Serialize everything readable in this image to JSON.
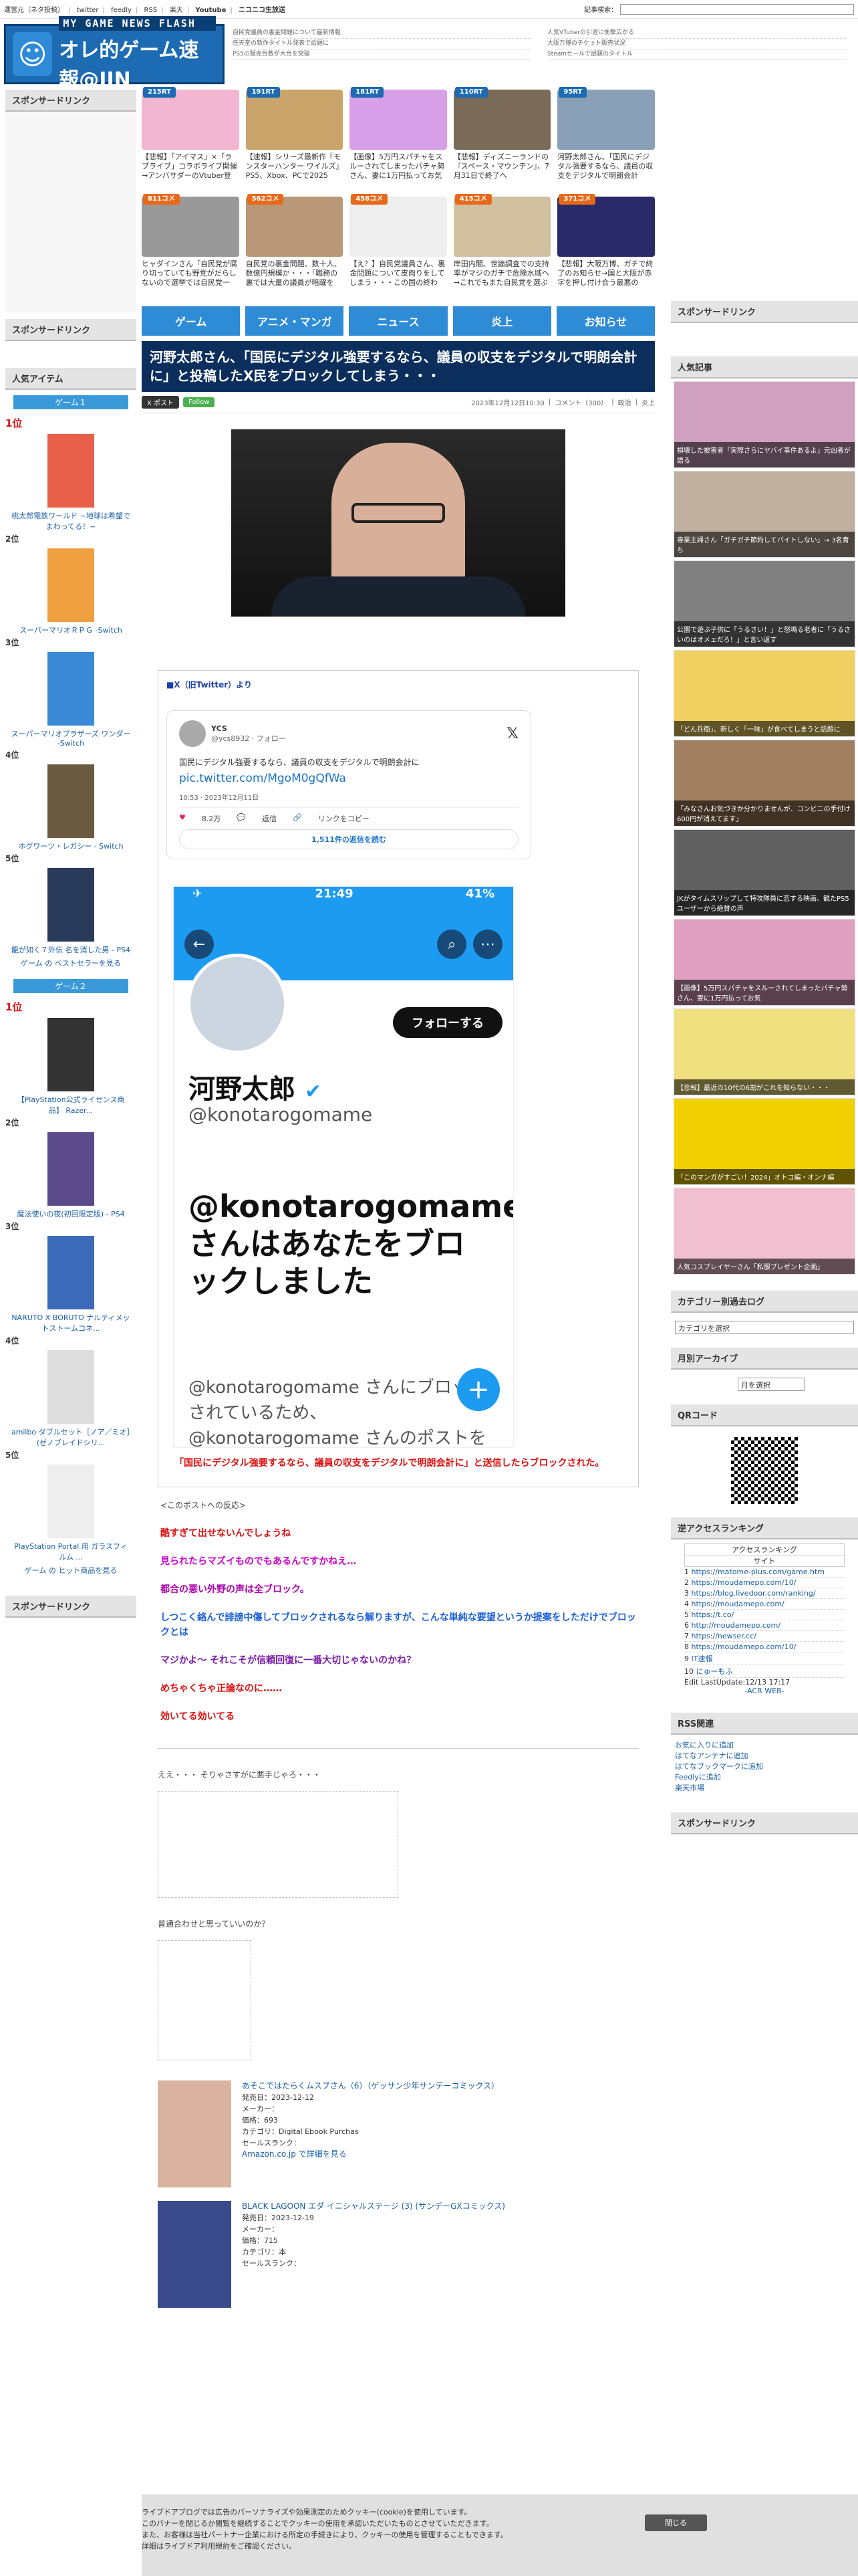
{
  "topbar": {
    "links": [
      "運営元（ネタ投稿）",
      "twitter",
      "feedly",
      "RSS",
      "楽天",
      "Youtube",
      "ニコニコ生放送"
    ],
    "search_label": "記事検索："
  },
  "header": {
    "logo_en": "MY GAME NEWS FLASH",
    "logo_jp": "オレ的ゲーム速報@JIN"
  },
  "trending": [
    {
      "badge": "215RT",
      "text": "【悲報】「アイマス」×「ラブライブ」コラボライブ開催→アンバサダーのVtuber登"
    },
    {
      "badge": "191RT",
      "text": "【速報】シリーズ最新作『モンスターハンター ワイルズ』PS5、Xbox、PCで2025"
    },
    {
      "badge": "181RT",
      "text": "【画像】5万円スパチャをスルーされてしまったパチャ勢さん、妻に1万円払ってお気"
    },
    {
      "badge": "110RT",
      "text": "【悲報】ディズニーランドの『スペース・マウンテン』、7月31日で終了へ"
    },
    {
      "badge": "95RT",
      "text": "河野太郎さん、「国民にデジタル強要するなら、議員の収支をデジタルで明朗会計"
    },
    {
      "badge": "811コメ",
      "text": "ヒャダインさん「自民党が腐り切っていても野党がだらしないので選挙では自民党一",
      "c": true
    },
    {
      "badge": "562コメ",
      "text": "自民党の裏金問題、数十人、数億円規模か・・・「職務の裏では大量の議員が暗躍を",
      "c": true
    },
    {
      "badge": "458コメ",
      "text": "【え？】自民党議員さん、裏金問題について皮肉りをしてしまう・・・この国の終わ",
      "c": true
    },
    {
      "badge": "415コメ",
      "text": "岸田内閣、世論調査での支持率がマジのガチで危険水域へ→これでもまた自民党を選ぶ",
      "c": true
    },
    {
      "badge": "371コメ",
      "text": "【悲報】大阪万博、ガチで終了のお知らせ→国と大阪が赤字を押し付け合う最悪の",
      "c": true
    }
  ],
  "newsticker": [
    "自民党議員の裏金問題について最新情報",
    "任天堂の新作タイトル発表で話題に",
    "PS5の販売台数が大台を突破",
    "人気VTuberの引退に衝撃広がる",
    "大阪万博のチケット販売状況",
    "Steamセールで話題のタイトル"
  ],
  "left": {
    "sponsor_title": "スポンサードリンク",
    "popular_title": "人気アイテム",
    "game1_tab": "ゲーム１",
    "game2_tab": "ゲーム２",
    "game1": [
      {
        "rank": "1位",
        "title": "桃太郎電鉄ワールド ~地球は希望でまわってる！~"
      },
      {
        "rank": "2位",
        "title": "スーパーマリオＲＰＧ -Switch"
      },
      {
        "rank": "3位",
        "title": "スーパーマリオブラザーズ ワンダー -Switch"
      },
      {
        "rank": "4位",
        "title": "ホグワーツ・レガシー - Switch"
      },
      {
        "rank": "5位",
        "title": "龍が如く７外伝 名を消した男 - PS4"
      }
    ],
    "game1_more": "ゲーム の ベストセラーを見る",
    "game2": [
      {
        "rank": "1位",
        "title": "【PlayStation公式ライセンス商品】 Razer..."
      },
      {
        "rank": "2位",
        "title": "魔法使いの夜(初回限定版) - PS4"
      },
      {
        "rank": "3位",
        "title": "NARUTO X BORUTO ナルティメットストームコネ..."
      },
      {
        "rank": "4位",
        "title": "amiibo ダブルセット［ノア／ミオ］(ゼノブレイドシリ..."
      },
      {
        "rank": "5位",
        "title": "PlayStation Portal 用 ガラスフィルム ..."
      }
    ],
    "game2_more": "ゲーム の ヒット商品を見る",
    "sponsor_bottom": "スポンサードリンク"
  },
  "nav": [
    "ゲーム",
    "アニメ・マンガ",
    "ニュース",
    "炎上",
    "お知らせ"
  ],
  "article": {
    "title": "河野太郎さん、「国民にデジタル強要するなら、議員の収支をデジタルで明朗会計に」と投稿したX民をブロックしてしまう・・・",
    "post_btn": "X ポスト",
    "follow_btn": "Follow",
    "date": "2023年12月12日10:30",
    "comments": "コメント（300）",
    "cat1": "政治",
    "cat2": "炎上",
    "source": "■X（旧Twitter）より",
    "tweet": {
      "name": "YCS",
      "handle": "@ycs8932 · フォロー",
      "body": "国民にデジタル強要するなら、議員の収支をデジタルで明朗会計に",
      "link": "pic.twitter.com/MgoM0gQfWa",
      "meta": "10:53 · 2023年12月11日",
      "likes": "8.2万",
      "reply": "返信",
      "copy": "リンクをコピー",
      "read": "1,511件の返信を読む"
    },
    "phone": {
      "time": "21:49",
      "battery": "41%",
      "follow": "フォローする",
      "name": "河野太郎",
      "handle": "@konotarogomame",
      "blocked": "@konotarogomame さんはあなたをブロックしました",
      "sub": "@konotarogomame さんにブロックされているため、@konotarogomame さんのポストを表示できません。"
    },
    "caption": "「国民にデジタル強要するなら、議員の収支をデジタルで明朗会計に」と送信したらブロックされた。",
    "reaction_header": "<このポストへの反応>",
    "reactions": [
      {
        "text": "酷すぎて出せないんでしょうね",
        "color": "#d11"
      },
      {
        "text": "見られたらマズイものでもあるんですかねえ…",
        "color": "#c0c"
      },
      {
        "text": "都合の悪い外野の声は全ブロック。",
        "color": "#a0a"
      },
      {
        "text": "しつこく絡んで誹謗中傷してブロックされるなら解りますが、こんな単純な要望というか提案をしただけでブロックとは",
        "color": "#1a5fd8"
      },
      {
        "text": "マジかよ～ それこそが信頼回復に一番大切じゃないのかね？",
        "color": "#7a1aa8"
      },
      {
        "text": "めちゃくちゃ正論なのに……",
        "color": "#d11"
      },
      {
        "text": "効いてる効いてる",
        "color": "#d11"
      }
    ],
    "aa1": "ええ・・・ そりゃさすがに悪手じゃろ・・・",
    "aa2": "普通合わせと思っていいのか？",
    "products": [
      {
        "title": "あそこではたらくムスブさん（6）（ゲッサン少年サンデーコミックス）",
        "date": "発売日：2023-12-12",
        "maker": "メーカー：",
        "price": "価格：693",
        "cat": "カテゴリ：Digital Ebook Purchas",
        "rank": "セールスランク：",
        "link": "Amazon.co.jp で詳細を見る"
      },
      {
        "title": "BLACK LAGOON エダ イニシャルステージ (3) (サンデーGXコミックス)",
        "date": "発売日：2023-12-19",
        "maker": "メーカー：",
        "price": "価格：715",
        "cat": "カテゴリ：本",
        "rank": "セールスランク：",
        "link": ""
      }
    ]
  },
  "right": {
    "sponsor": "スポンサードリンク",
    "popular": "人気記事",
    "popular_items": [
      "損壊した被害者「実際さらにヤバイ事件あるよ」元凶者が語る",
      "専業主婦さん「ガチガチ節約してバイトしない」→ 3名育ち",
      "公園で遊ぶ子供に「うるさい！」と怒鳴る老者に「うるさいのはオメェだろ！」と言い返す",
      "「どん兵衛」、新しく「一味」が食べてしまうと話題に",
      "「みなさんお気づきか分かりませんが、コンビニの手付け600円が消えてます」",
      "JKがタイムスリップして特攻隊員に恋する映画、観たPS5ユーザーから絶賛の声",
      "【画像】5万円スパチャをスルーされてしまったパチャ勢さん、妻に1万円払ってお気",
      "【悲報】最近の10代の6割がこれを知らない・・・",
      "「このマンガがすごい！2024」オトコ編・オンナ編",
      "人気コスプレイヤーさん「私服プレゼント企画」"
    ],
    "cat_title": "カテゴリー別過去ログ",
    "cat_select": "カテゴリを選択",
    "month_title": "月別アーカイブ",
    "month_select": "月を選択",
    "qr_title": "QRコード",
    "access_title": "逆アクセスランキング",
    "access_head": "アクセスランキング",
    "access_sub": "サイト",
    "access": [
      "https://matome-plus.com/game.htm",
      "https://moudamepo.com/10/",
      "https://blog.livedoor.com/ranking/",
      "https://moudamepo.com/",
      "https://t.co/",
      "http://moudamepo.com/",
      "https://newser.cc/",
      "https://moudamepo.com/10/",
      "IT速報",
      "にゅーもふ"
    ],
    "access_updated": "Edit LastUpdate:12/13 17:17",
    "access_footer": "-ACR WEB-",
    "rss_title": "RSS関連",
    "rss": [
      "お気に入りに追加",
      "はてなアンテナに追加",
      "はてなブックマークに追加",
      "Feedlyに追加",
      "楽天市場"
    ],
    "sponsor2": "スポンサードリンク"
  },
  "cookie": {
    "lines": [
      "ライブドアブログでは広告のパーソナライズや効果測定のためクッキー(cookie)を使用しています。",
      "このバナーを閉じるか閲覧を継続することでクッキーの使用を承認いただいたものとさせていただきます。",
      "また、お客様は当社パートナー企業における所定の手続きにより、クッキーの使用を管理することもできます。",
      "詳細はライブドア利用規約をご確認ください。"
    ],
    "close": "閉じる"
  },
  "colors": {
    "brand": "#1c6bb3",
    "nav": "#2e8bd6",
    "title_bg": "#0b2e5c",
    "twitter": "#1d9bf0"
  }
}
